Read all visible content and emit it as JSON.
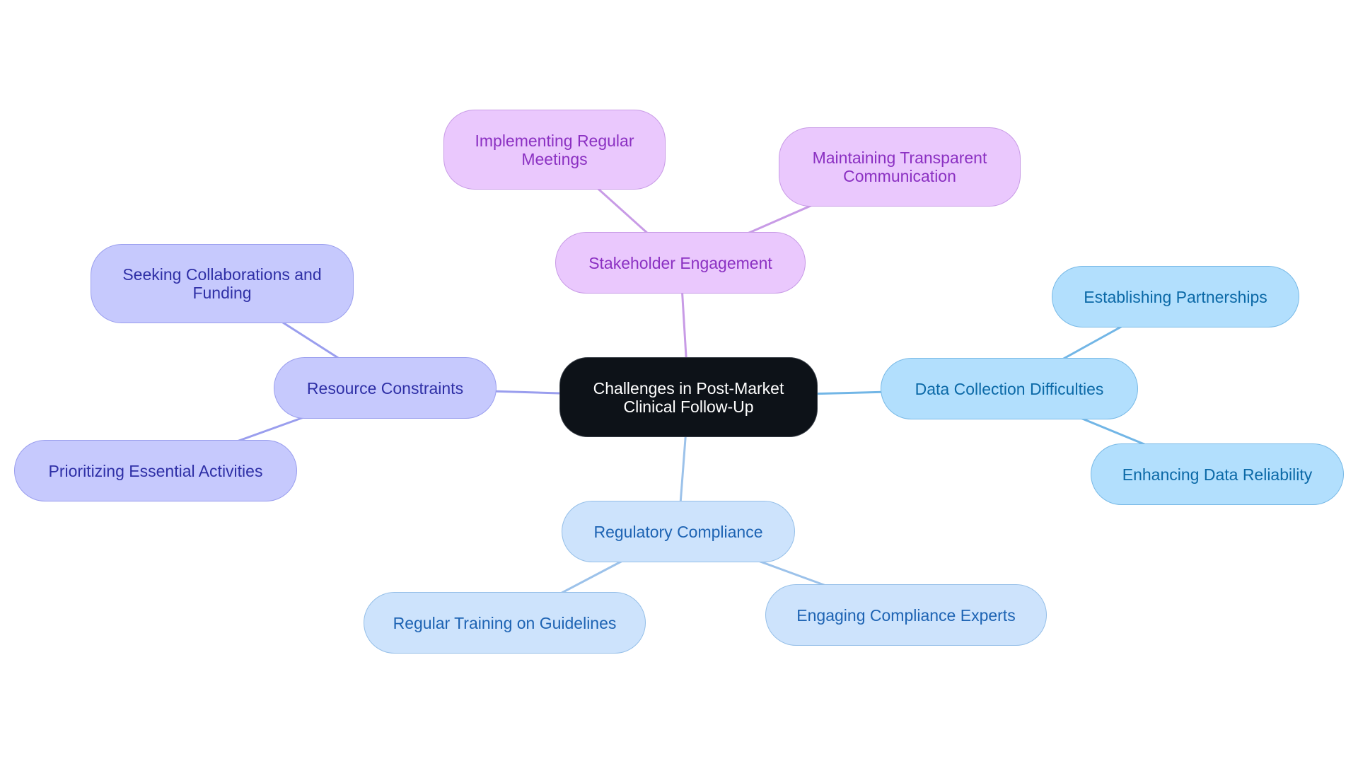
{
  "diagram": {
    "type": "mind-map",
    "root": {
      "id": "root",
      "label": "Challenges in Post-Market Clinical Follow-Up",
      "color": "#0d1218"
    },
    "branches": [
      {
        "id": "stakeholder",
        "label": "Stakeholder Engagement",
        "theme": "purple",
        "line_color": "#c89be6",
        "children": [
          {
            "id": "meetings",
            "label": "Implementing Regular Meetings"
          },
          {
            "id": "communication",
            "label": "Maintaining Transparent Communication"
          }
        ]
      },
      {
        "id": "data",
        "label": "Data Collection Difficulties",
        "theme": "sky",
        "line_color": "#72b6e6",
        "children": [
          {
            "id": "partnerships",
            "label": "Establishing Partnerships"
          },
          {
            "id": "reliability",
            "label": "Enhancing Data Reliability"
          }
        ]
      },
      {
        "id": "regulatory",
        "label": "Regulatory Compliance",
        "theme": "light",
        "line_color": "#9cc2ea",
        "children": [
          {
            "id": "training",
            "label": "Regular Training on Guidelines"
          },
          {
            "id": "experts",
            "label": "Engaging Compliance Experts"
          }
        ]
      },
      {
        "id": "resource",
        "label": "Resource Constraints",
        "theme": "indigo",
        "line_color": "#9a9eee",
        "children": [
          {
            "id": "collab",
            "label": "Seeking Collaborations and Funding"
          },
          {
            "id": "prioritizing",
            "label": "Prioritizing Essential Activities"
          }
        ]
      }
    ]
  }
}
